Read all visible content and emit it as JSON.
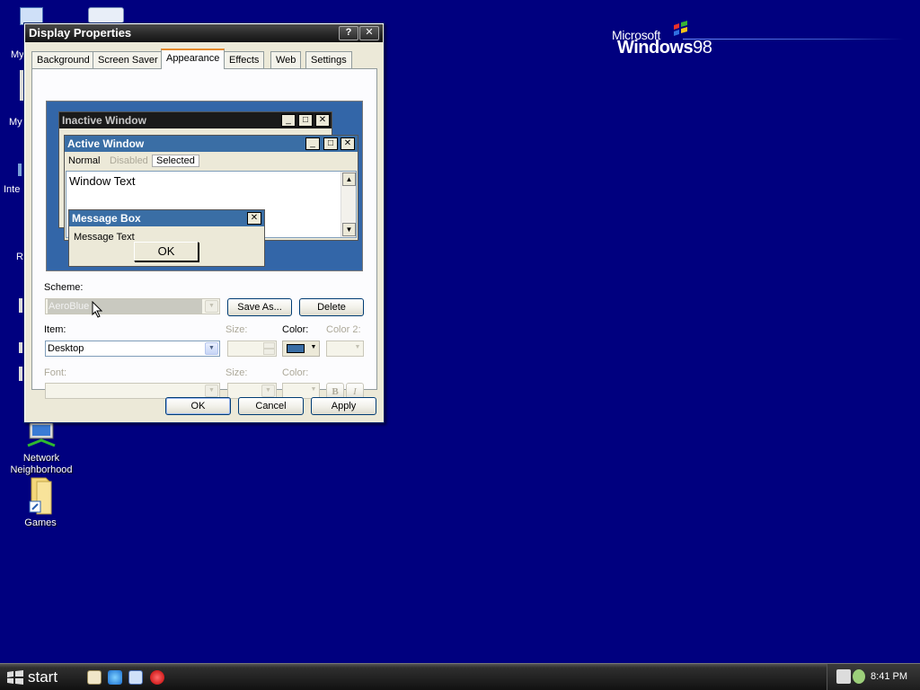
{
  "desktop": {
    "icons": [
      {
        "id": "network",
        "label_line1": "Network",
        "label_line2": "Neighborhood"
      },
      {
        "id": "games",
        "label": "Games"
      }
    ],
    "partial_labels": [
      "My",
      "My",
      "Inte",
      "R"
    ],
    "logo": {
      "ms": "Microsoft",
      "windows": "Windows",
      "ver": "98"
    }
  },
  "dialog": {
    "title": "Display Properties",
    "tabs": [
      "Background",
      "Screen Saver",
      "Appearance",
      "Effects",
      "Web",
      "Settings"
    ],
    "active_tab": "Appearance",
    "preview": {
      "inactive_title": "Inactive Window",
      "active_title": "Active Window",
      "menu_normal": "Normal",
      "menu_disabled": "Disabled",
      "menu_selected": "Selected",
      "window_text": "Window Text",
      "msgbox_title": "Message Box",
      "msgbox_text": "Message Text",
      "msgbox_ok": "OK"
    },
    "scheme": {
      "label": "Scheme:",
      "value": "AeroBlue",
      "save_as": "Save As...",
      "delete": "Delete"
    },
    "item": {
      "label": "Item:",
      "value": "Desktop",
      "size_label": "Size:",
      "color_label": "Color:",
      "color2_label": "Color 2:",
      "color_value": "#3a6ea5"
    },
    "font": {
      "label": "Font:",
      "size_label": "Size:",
      "color_label": "Color:",
      "bold": "B",
      "italic": "I"
    },
    "buttons": {
      "ok": "OK",
      "cancel": "Cancel",
      "apply": "Apply"
    }
  },
  "taskbar": {
    "start": "start",
    "clock": "8:41 PM"
  },
  "colors": {
    "desktop": "#00007f",
    "active_title": "#3a6ea5",
    "inactive_title": "#1a1a1a"
  }
}
